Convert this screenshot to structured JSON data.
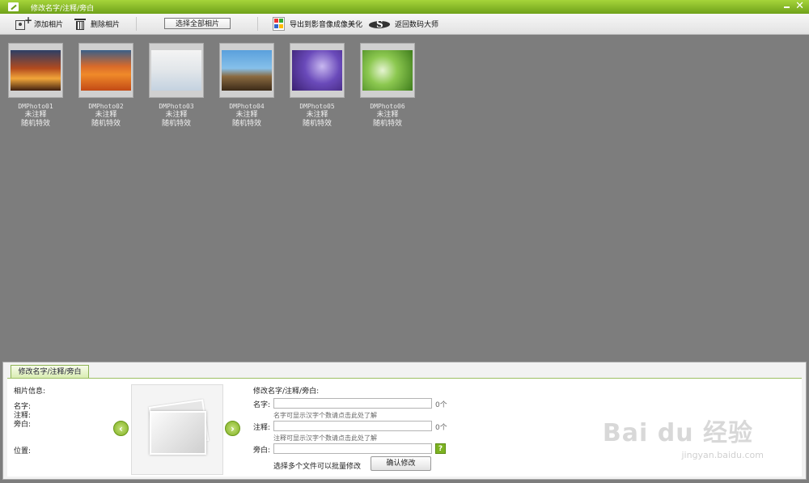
{
  "window": {
    "title": "修改名字/注释/旁白",
    "close_glyph": "✕"
  },
  "toolbar": {
    "add_photo": "添加相片",
    "delete_photo": "删除相片",
    "select_all": "选择全部相片",
    "export": "导出到影音像成像美化",
    "return": "返回数码大师"
  },
  "photos": [
    {
      "name": "DMPhoto01",
      "note": "未注释",
      "effect": "随机特效"
    },
    {
      "name": "DMPhoto02",
      "note": "未注释",
      "effect": "随机特效"
    },
    {
      "name": "DMPhoto03",
      "note": "未注释",
      "effect": "随机特效"
    },
    {
      "name": "DMPhoto04",
      "note": "未注释",
      "effect": "随机特效"
    },
    {
      "name": "DMPhoto05",
      "note": "未注释",
      "effect": "随机特效"
    },
    {
      "name": "DMPhoto06",
      "note": "未注释",
      "effect": "随机特效"
    }
  ],
  "panel": {
    "tab": "修改名字/注释/旁白",
    "info_title": "相片信息:",
    "name_label": "名字:",
    "note_label": "注释:",
    "narration_label": "旁白:",
    "position_label": "位置:",
    "prev_glyph": "‹",
    "next_glyph": "›",
    "edit_title": "修改名字/注释/旁白:",
    "edit_name_label": "名字:",
    "edit_name_value": "",
    "edit_name_count": "0个",
    "edit_name_hint": "名字可显示汉字个数请点击此处了解",
    "edit_note_label": "注释:",
    "edit_note_value": "",
    "edit_note_count": "0个",
    "edit_note_hint": "注释可显示汉字个数请点击此处了解",
    "edit_narration_label": "旁白:",
    "edit_narration_value": "",
    "help_glyph": "?",
    "batch_hint": "选择多个文件可以批量修改",
    "confirm": "确认修改"
  },
  "watermark": {
    "main": "Bai du 经验",
    "sub": "jingyan.baidu.com"
  },
  "colors": {
    "accent": "#7db322",
    "canvas": "#7d7d7d",
    "titlebar": "#8fc02a"
  }
}
